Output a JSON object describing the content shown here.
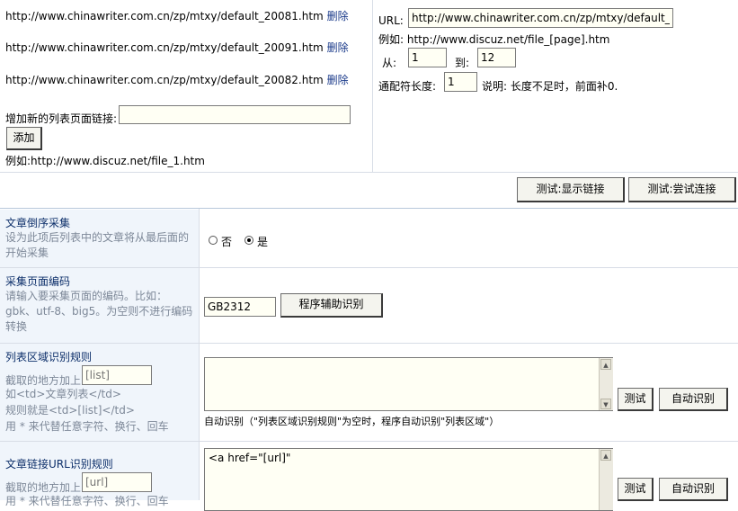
{
  "list_pages": {
    "urls": [
      "http://www.chinawriter.com.cn/zp/mtxy/default_20081.htm",
      "http://www.chinawriter.com.cn/zp/mtxy/default_20091.htm",
      "http://www.chinawriter.com.cn/zp/mtxy/default_20082.htm"
    ],
    "delete_label": "删除",
    "add_label": "增加新的列表页面链接:",
    "add_value": "",
    "add_button": "添加",
    "add_example": "例如:http://www.discuz.net/file_1.htm"
  },
  "pattern": {
    "url_label": "URL:",
    "url_value": "http://www.chinawriter.com.cn/zp/mtxy/default_[page].htm",
    "example": "例如: http://www.discuz.net/file_[page].htm",
    "from_label": "从:",
    "from_value": "1",
    "to_label": "到:",
    "to_value": "12",
    "wildcard_label": "通配符长度:",
    "wildcard_value": "1",
    "wildcard_note": "说明: 长度不足时，前面补0."
  },
  "tests": {
    "show_links": "测试:显示链接",
    "try_connect": "测试:尝试连接"
  },
  "rows": {
    "reverse": {
      "title": "文章倒序采集",
      "desc": "设为此项后列表中的文章将从最后面的开始采集",
      "opt_no": "否",
      "opt_yes": "是"
    },
    "encoding": {
      "title": "采集页面编码",
      "desc": "请输入要采集页面的编码。比如：gbk、utf-8、big5。为空则不进行编码转换",
      "value": "GB2312",
      "button": "程序辅助识别"
    },
    "list_area": {
      "title": "列表区域识别规则",
      "cut_label": "截取的地方加上",
      "placeholder": "[list]",
      "line2": "如<td>文章列表</td>",
      "line3": "规则就是<td>[list]</td>",
      "line4": "用 * 来代替任意字符、换行、回车",
      "textarea": "",
      "test_btn": "测试",
      "auto_btn": "自动识别",
      "auto_note": "自动识别（\"列表区域识别规则\"为空时，程序自动识别\"列表区域\"）"
    },
    "article_url": {
      "title": "文章链接URL识别规则",
      "cut_label": "截取的地方加上",
      "placeholder": "[url]",
      "line2": "用 * 来代替任意字符、换行、回车",
      "textarea": "<a href=\"[url]\"",
      "test_btn": "测试",
      "auto_btn": "自动识别"
    }
  },
  "colors": {
    "label_bg": "#f0f5fb",
    "title": "#0d2f6a",
    "desc": "#7d8898",
    "input_bg": "#fffff4"
  }
}
